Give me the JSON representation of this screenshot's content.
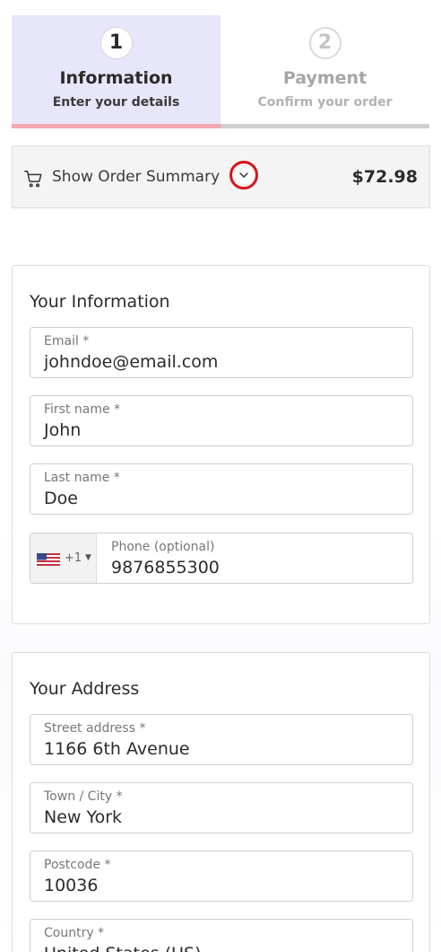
{
  "steps": [
    {
      "number": "1",
      "title": "Information",
      "subtitle": "Enter your details",
      "active": true
    },
    {
      "number": "2",
      "title": "Payment",
      "subtitle": "Confirm your order",
      "active": false
    }
  ],
  "summary": {
    "label": "Show Order Summary",
    "total": "$72.98",
    "icons": {
      "cart": "cart-icon",
      "toggle": "chevron-down-icon"
    }
  },
  "info_section": {
    "title": "Your Information",
    "email": {
      "label": "Email *",
      "value": "johndoe@email.com"
    },
    "first_name": {
      "label": "First name *",
      "value": "John"
    },
    "last_name": {
      "label": "Last name *",
      "value": "Doe"
    },
    "phone": {
      "label": "Phone (optional)",
      "value": "9876855300",
      "country_code": "+1",
      "flag": "us-flag-icon"
    }
  },
  "address_section": {
    "title": "Your Address",
    "street": {
      "label": "Street address *",
      "value": "1166 6th Avenue"
    },
    "city": {
      "label": "Town / City *",
      "value": "New York"
    },
    "postcode": {
      "label": "Postcode *",
      "value": "10036"
    },
    "country": {
      "label": "Country *",
      "value": "United States (US)"
    }
  },
  "colors": {
    "accent_active": "#e7e6fb",
    "progress_active": "#f4a8b0",
    "highlight_ring": "#d6151b"
  }
}
